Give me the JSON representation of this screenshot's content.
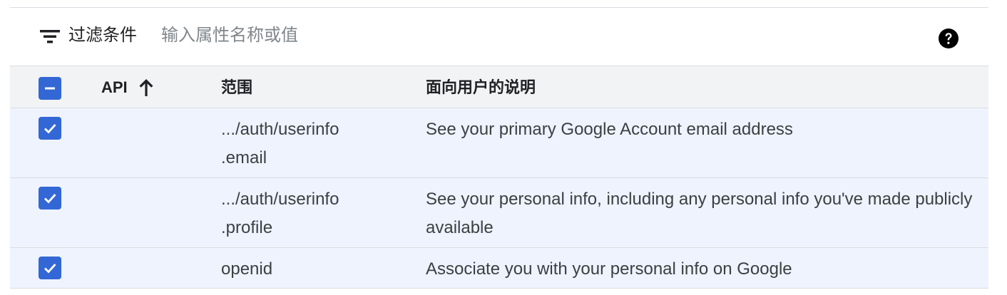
{
  "filter": {
    "label": "过滤条件",
    "placeholder": "输入属性名称或值",
    "value": ""
  },
  "icons": {
    "filter": "filter-list-icon",
    "help": "help-circle-icon",
    "sort": "arrow-up-icon",
    "check": "check-icon",
    "indeterminate": "minus-icon"
  },
  "colors": {
    "checkbox_accent": "#3367d6",
    "selected_row_bg": "#eef3fd",
    "header_bg": "#f1f3f4"
  },
  "table": {
    "headers": {
      "api": "API",
      "scope": "范围",
      "description": "面向用户的说明"
    },
    "select_all_state": "indeterminate",
    "rows": [
      {
        "checked": true,
        "api": "",
        "scope_line1": ".../auth/userinfo",
        "scope_line2": ".email",
        "description": "See your primary Google Account email address"
      },
      {
        "checked": true,
        "api": "",
        "scope_line1": ".../auth/userinfo",
        "scope_line2": ".profile",
        "description": "See your personal info, including any personal info you've made publicly available"
      },
      {
        "checked": true,
        "api": "",
        "scope_line1": "openid",
        "scope_line2": "",
        "description": "Associate you with your personal info on Google"
      }
    ]
  }
}
